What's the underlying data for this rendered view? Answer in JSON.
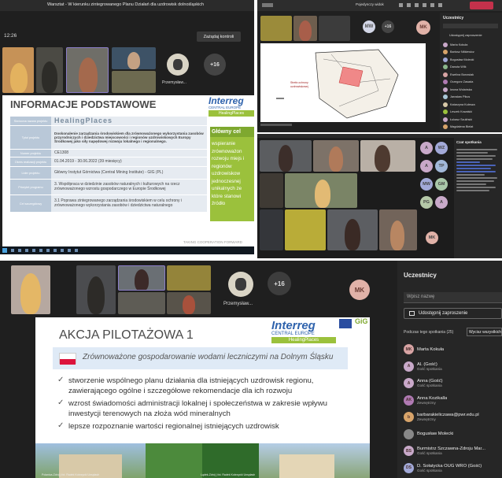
{
  "topleft": {
    "window_title": "Warsztat - W kierunku zintegrowanego Planu Działań dla uzdrowisk dolnośląskich",
    "time": "12:26",
    "control_button": "Zażądaj kontroli",
    "participant_name": "Przemysław...",
    "extra_count": "+16",
    "slide": {
      "title": "INFORMACJE PODSTAWOWE",
      "logo_main": "Interreg",
      "logo_sub": "CENTRAL EUROPE",
      "logo_project": "HealingPlaces",
      "side_header": "Główny cel",
      "side_text": "wspieranie zrównoważon rozwoju miejs i regionów uzdrowiskow jednoczesnej unikalnych ze które stanowi źródło",
      "rows": [
        {
          "label": "Skrócona nazwa projektu",
          "value": "HealingPlaces"
        },
        {
          "label": "Tytuł projektu",
          "value": "Doskonalenie zarządzania środowiskiem dla zrównoważonego wykorzystania zasobów przyrodniczych i dziedzictwa miejscowości i regionów uzdrowiskowych Europy Środkowej jako siły napędowej rozwoju lokalnego i regionalnego."
        },
        {
          "label": "Numer projektu",
          "value": "CE1308"
        },
        {
          "label": "Okres realizacji projektu",
          "value": "01.04.2019 - 30.06.2022 (39 miesięcy)"
        },
        {
          "label": "Lider projektu",
          "value": "Główny Instytut Górnictwa (Central Mining Institute) - GIG (PL)"
        },
        {
          "label": "Priorytet programu",
          "value": "3. Współpraca w dziedzinie zasobów naturalnych i kulturowych na rzecz zrównoważonego wzrostu gospodarczego w Europie Środkowej"
        },
        {
          "label": "Cel szczegółowy",
          "value": "3.1 Poprawa zintegrowanego zarządzania środowiskiem w celu ochrony i zrównoważonego wykorzystania zasobów i dziedzictwa naturalnego"
        }
      ],
      "footer": "TAKING COOPERATION FORWARD"
    }
  },
  "topright": {
    "toolbar_label": "Pojedynczy widok",
    "avatars": [
      "MW",
      "MK"
    ],
    "extra": "+16",
    "panel_title": "Uczestnicy",
    "share_label": "Udostępnij zaproszenie",
    "map_legend": "Strefa ochrony uzdrowiskowej",
    "participants": [
      "Marta Kokuła",
      "Bartosz Nitkiewicz",
      "Bogusław Molecki",
      "Danuta Wilk",
      "Ewelina Borowiak",
      "Grzegorz Zasada",
      "Iwona Wolańska",
      "Jarosław Pikus",
      "Katarzyna Kulesza",
      "Leszek Kowalski",
      "Łukasz Szuliński",
      "Magdalena Bielat"
    ]
  },
  "midright": {
    "avatars": [
      "A",
      "WZ",
      "A",
      "TP",
      "MW",
      "GM",
      "PG",
      "A",
      "MK"
    ],
    "chat_title": "Czat spotkania",
    "names": [
      "Przemysław Sajdak",
      "Michał Dąbrowski",
      "Paweł Kociński",
      "Agnieszka Nowak",
      "Gość",
      "Bartosz",
      "Ewelina"
    ]
  },
  "bottom": {
    "participant_name": "Przemysław...",
    "extra_count": "+16",
    "my_avatar": "MK",
    "panel_title": "Uczestnicy",
    "search_placeholder": "Wpisz nazwę",
    "share_button": "Udostępnij zaproszenie",
    "section_label": "Podczas tego spotkania (25)",
    "mute_all": "Wycisz wszystkich",
    "participants": [
      {
        "initials": "MK",
        "name": "Marta Kokuła",
        "role": "",
        "color": "#d8a4a4"
      },
      {
        "initials": "A",
        "name": "Al. (Gość)",
        "role": "Gość spotkania",
        "color": "#c8a9c9"
      },
      {
        "initials": "A",
        "name": "Anna (Gość)",
        "role": "Gość spotkania",
        "color": "#c9a8c9"
      },
      {
        "initials": "AK",
        "name": "Anna Kozikalla",
        "role": "Zewnętrzny",
        "color": "#b07ab3"
      },
      {
        "initials": "b",
        "name": "barbarakieliczawa@pwr.edu.pl",
        "role": "Zewnętrzny",
        "color": "#d8a46a"
      },
      {
        "initials": "",
        "name": "Bogusław Molecki",
        "role": "",
        "color": "#888888"
      },
      {
        "initials": "BS",
        "name": "Burmistrz Szczawna-Zdroju Mar...",
        "role": "Gość spotkania",
        "color": "#c8a9c9"
      },
      {
        "initials": "DS",
        "name": "D. Sołatycka OUG WRO (Gość)",
        "role": "Gość spotkania",
        "color": "#a2a9d8"
      }
    ],
    "slide": {
      "title": "AKCJA PILOTAŻOWA 1",
      "logo_main": "Interreg",
      "logo_sub": "CENTRAL EUROPE",
      "logo_project": "HealingPlaces",
      "gig": "GiG",
      "banner": "Zrównoważone gospodarowanie wodami leczniczymi na Dolnym Śląsku",
      "bullets": [
        "stworzenie wspólnego planu działania dla istniejących uzdrowisk regionu, zawierającego ogólne i szczegółowe rekomendacje dla ich rozwoju",
        "wzrost świadomości administracji lokalnej i społeczeństwa w zakresie wpływu inwestycji terenowych na złoża wód mineralnych",
        "lepsze rozpoznanie wartości regionalnej istniejących uzdrowisk"
      ],
      "caption_left": "Polanica-Zdrój | fot. Radek Kobrzycki Unsplash",
      "caption_right": "Lądek-Zdrój | fot. Radek Kobrzycki Unsplash"
    }
  }
}
